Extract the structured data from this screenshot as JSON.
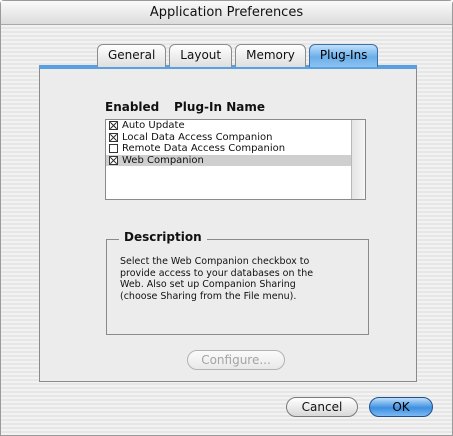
{
  "window": {
    "title": "Application Preferences"
  },
  "tabs": [
    {
      "label": "General",
      "selected": false
    },
    {
      "label": "Layout",
      "selected": false
    },
    {
      "label": "Memory",
      "selected": false
    },
    {
      "label": "Plug-Ins",
      "selected": true
    }
  ],
  "plugins": {
    "enabled_header": "Enabled",
    "name_header": "Plug-In Name",
    "items": [
      {
        "name": "Auto Update",
        "enabled": true,
        "selected": false
      },
      {
        "name": "Local Data Access Companion",
        "enabled": true,
        "selected": false
      },
      {
        "name": "Remote Data Access Companion",
        "enabled": false,
        "selected": false
      },
      {
        "name": "Web Companion",
        "enabled": true,
        "selected": true
      }
    ]
  },
  "description": {
    "title": "Description",
    "lines": [
      "Select the Web Companion checkbox to",
      "provide access to your databases on the",
      "Web. Also set up Companion Sharing",
      "(choose Sharing from the File menu)."
    ]
  },
  "buttons": {
    "configure_label": "Configure...",
    "configure_enabled": false,
    "cancel_label": "Cancel",
    "ok_label": "OK",
    "ok_default": true
  },
  "colors": {
    "accent": "#5a9fe0",
    "selected_row": "#cfcfcf"
  }
}
